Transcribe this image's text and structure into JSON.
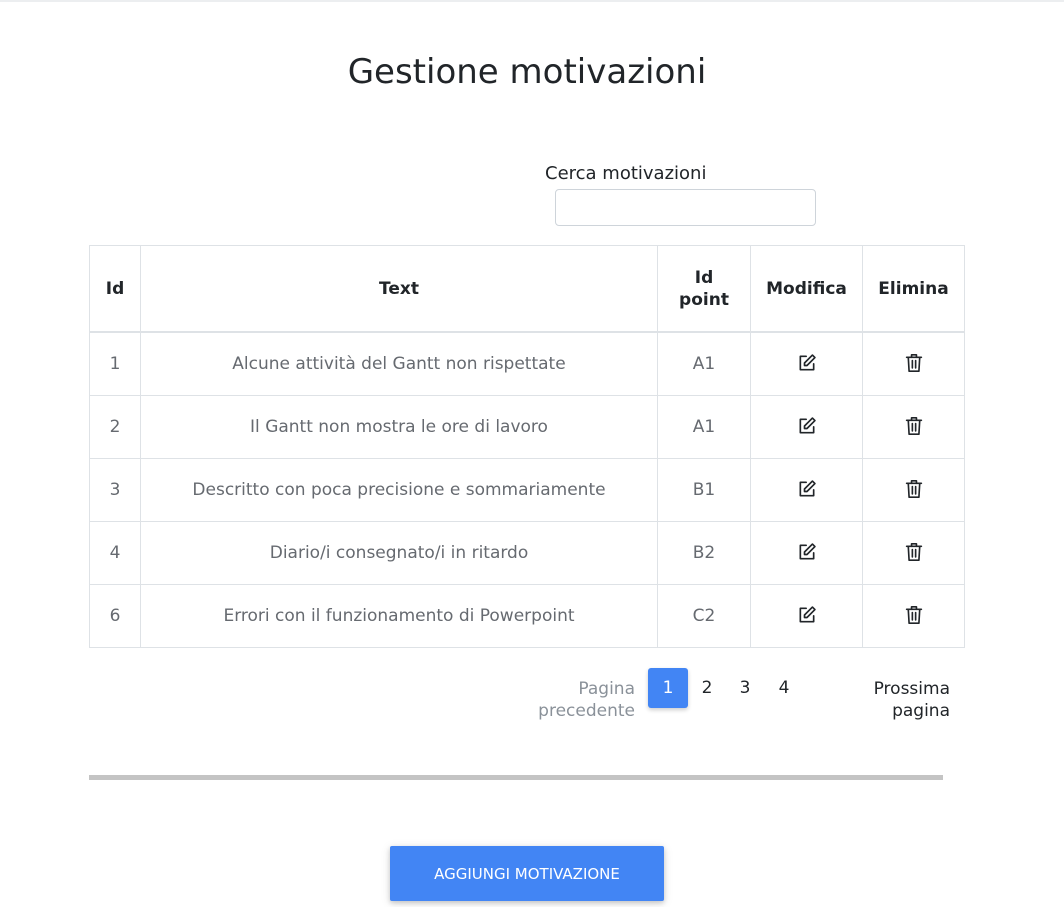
{
  "page": {
    "title": "Gestione motivazioni"
  },
  "search": {
    "label": "Cerca motivazioni",
    "value": "",
    "placeholder": ""
  },
  "table": {
    "headers": {
      "id": "Id",
      "text": "Text",
      "id_point": "Id point",
      "edit": "Modifica",
      "delete": "Elimina"
    },
    "rows": [
      {
        "id": "1",
        "text": "Alcune attività del Gantt non rispettate",
        "id_point": "A1"
      },
      {
        "id": "2",
        "text": "Il Gantt non mostra le ore di lavoro",
        "id_point": "A1"
      },
      {
        "id": "3",
        "text": "Descritto con poca precisione e sommariamente",
        "id_point": "B1"
      },
      {
        "id": "4",
        "text": "Diario/i consegnato/i in ritardo",
        "id_point": "B2"
      },
      {
        "id": "6",
        "text": "Errori con il funzionamento di Powerpoint",
        "id_point": "C2"
      }
    ],
    "edit_icon": "edit-icon",
    "delete_icon": "trash-icon"
  },
  "pagination": {
    "prev_label": "Pagina precedente",
    "next_label": "Prossima pagina",
    "pages": [
      "1",
      "2",
      "3",
      "4"
    ],
    "current": "1"
  },
  "actions": {
    "add_label": "AGGIUNGI MOTIVAZIONE"
  },
  "colors": {
    "primary": "#4285f4",
    "divider": "#c4c4c4"
  }
}
